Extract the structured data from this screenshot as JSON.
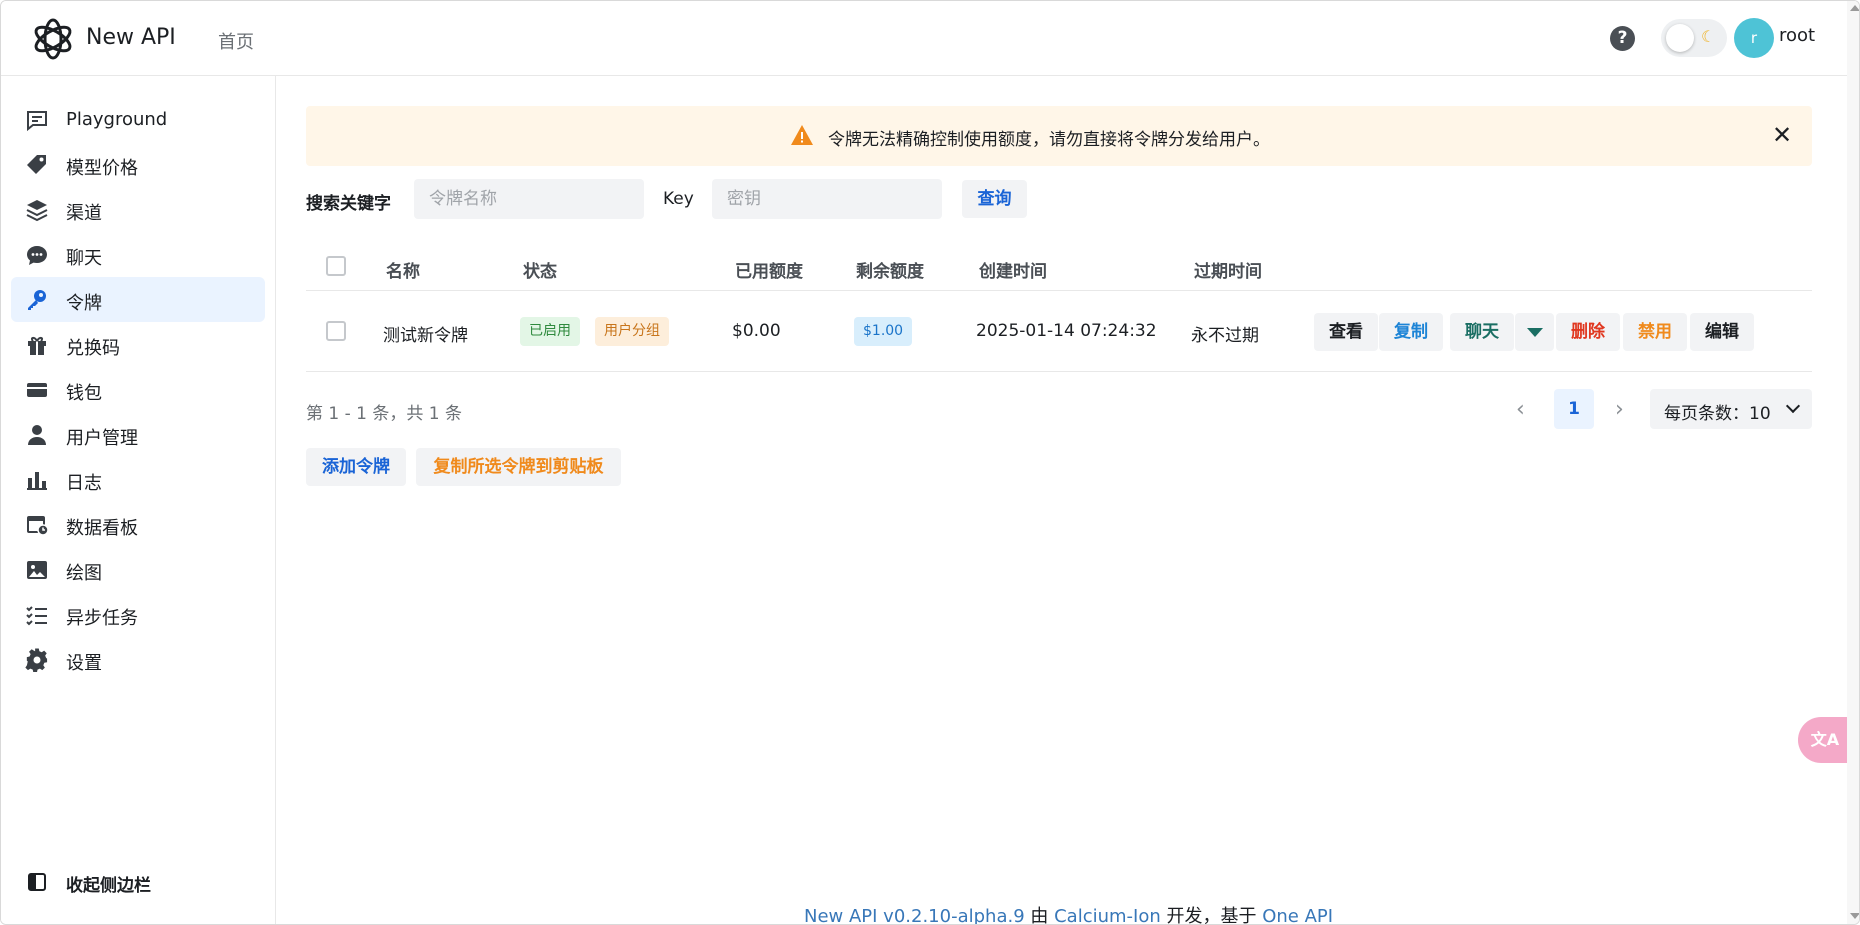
{
  "header": {
    "app_title": "New API",
    "nav_home": "首页",
    "help": "?",
    "avatar_initial": "r",
    "username": "root"
  },
  "sidebar": {
    "items": [
      {
        "label": "Playground",
        "icon": "chat-square-icon"
      },
      {
        "label": "模型价格",
        "icon": "price-tag-icon"
      },
      {
        "label": "渠道",
        "icon": "layers-icon"
      },
      {
        "label": "聊天",
        "icon": "chat-bubble-icon"
      },
      {
        "label": "令牌",
        "icon": "key-icon"
      },
      {
        "label": "兑换码",
        "icon": "gift-icon"
      },
      {
        "label": "钱包",
        "icon": "credit-card-icon"
      },
      {
        "label": "用户管理",
        "icon": "user-icon"
      },
      {
        "label": "日志",
        "icon": "bar-chart-icon"
      },
      {
        "label": "数据看板",
        "icon": "calendar-clock-icon"
      },
      {
        "label": "绘图",
        "icon": "image-icon"
      },
      {
        "label": "异步任务",
        "icon": "checklist-icon"
      },
      {
        "label": "设置",
        "icon": "gear-icon"
      }
    ],
    "active_index": 4,
    "collapse_label": "收起侧边栏"
  },
  "banner": {
    "text": "令牌无法精确控制使用额度，请勿直接将令牌分发给用户。"
  },
  "search": {
    "label": "搜索关键字",
    "name_placeholder": "令牌名称",
    "key_label": "Key",
    "key_placeholder": "密钥",
    "query_button": "查询"
  },
  "table": {
    "columns": [
      "名称",
      "状态",
      "已用额度",
      "剩余额度",
      "创建时间",
      "过期时间"
    ],
    "rows": [
      {
        "name": "测试新令牌",
        "status": "已启用",
        "group": "用户分组",
        "used": "$0.00",
        "remaining": "$1.00",
        "created": "2025-01-14 07:24:32",
        "expires": "永不过期",
        "actions": {
          "view": "查看",
          "copy": "复制",
          "chat": "聊天",
          "delete": "删除",
          "disable": "禁用",
          "edit": "编辑"
        }
      }
    ]
  },
  "pagination": {
    "range_text": "第 1 - 1 条，共 1 条",
    "current_page": "1",
    "page_size_label": "每页条数：10"
  },
  "bottom_actions": {
    "add": "添加令牌",
    "copy_selected": "复制所选令牌到剪贴板"
  },
  "footer": {
    "link1": "New API v0.2.10-alpha.9",
    "by": " 由 ",
    "link2": "Calcium-Ion",
    "mid": " 开发，基于 ",
    "link3": "One API"
  },
  "colors": {
    "accent": "#1a64d6",
    "warning": "#f08a1c",
    "danger": "#e0371f",
    "success": "#2f8a3e"
  }
}
